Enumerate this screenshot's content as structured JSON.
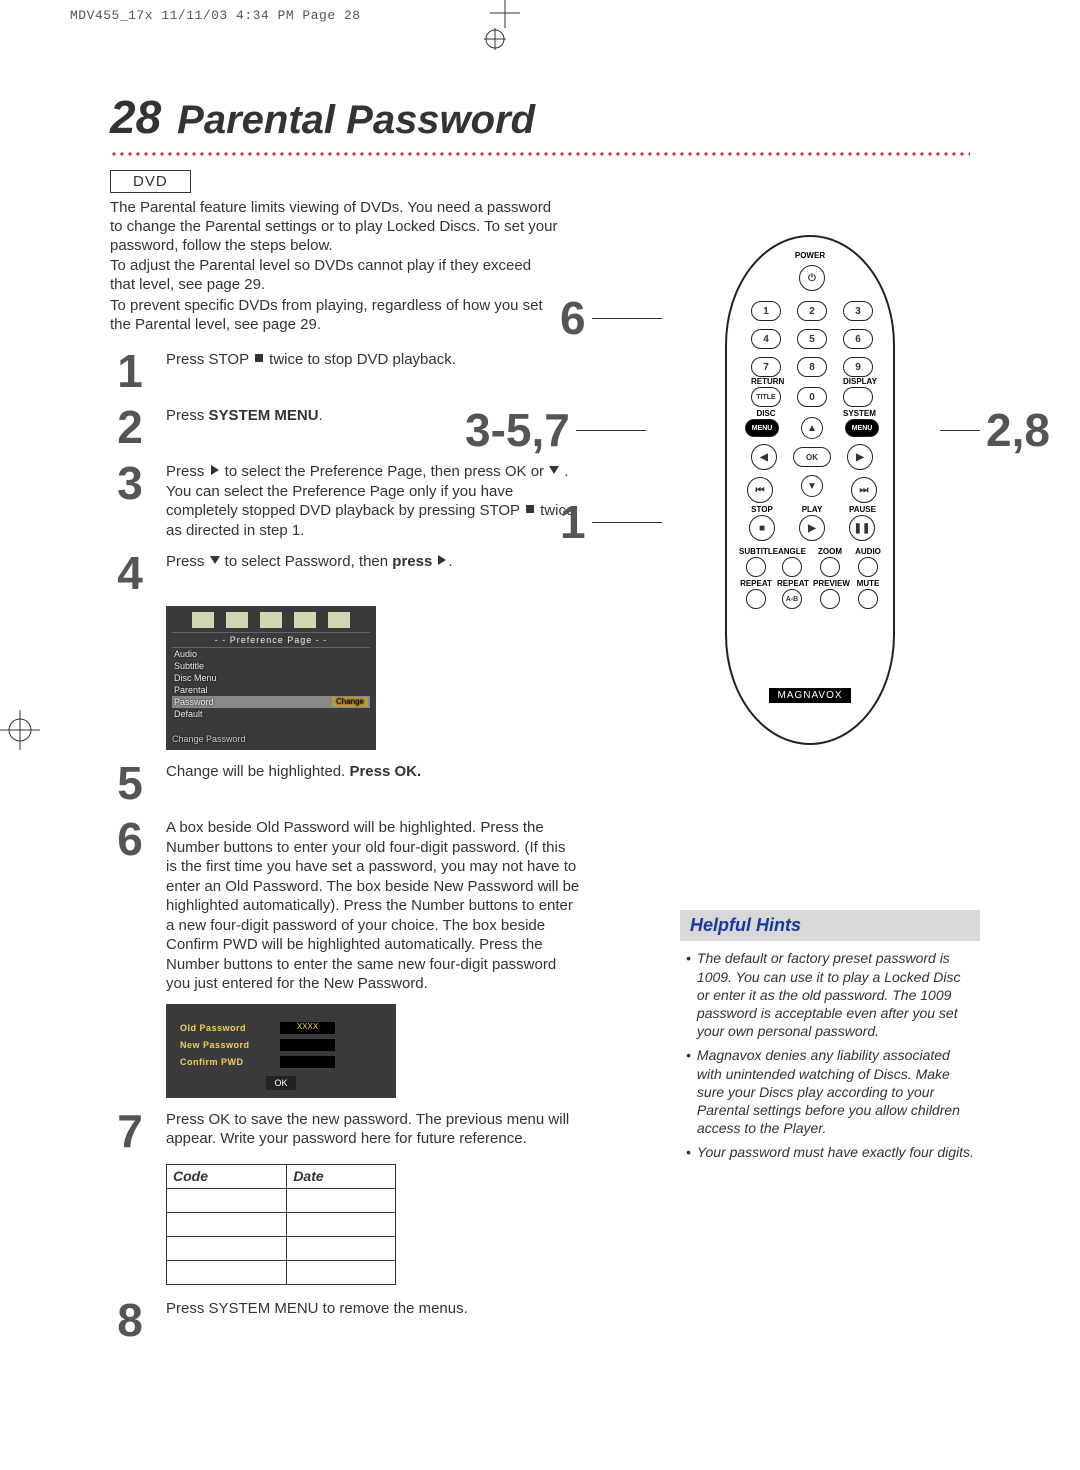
{
  "print_header": "MDV455_17x  11/11/03  4:34 PM  Page 28",
  "page_number": "28",
  "page_title": "Parental Password",
  "dvd_label": "DVD",
  "intro": {
    "p1": "The Parental feature limits viewing of DVDs. You need a password to change the Parental settings or to play Locked Discs. To set your password, follow the steps below.",
    "p2": "To adjust the Parental level so DVDs cannot play if they exceed that level, see page 29.",
    "p3": "To prevent specific DVDs from playing, regardless of how you set the Parental level, see page 29."
  },
  "steps": {
    "s1": {
      "n": "1",
      "a": "Press STOP ",
      "b": " twice to stop DVD playback."
    },
    "s2": {
      "n": "2",
      "a": "Press ",
      "bold": "SYSTEM MENU",
      "b": "."
    },
    "s3": {
      "n": "3",
      "a": "Press ",
      "b": " to select the Preference Page, then press OK or ",
      "c": " . You can select the Preference Page only if you have completely stopped DVD playback by pressing STOP ",
      "d": " twice as directed in step 1."
    },
    "s4": {
      "n": "4",
      "a": "Press ",
      "b": " to select Password, then ",
      "bold": "press ",
      "c": "."
    },
    "s5": {
      "n": "5",
      "a": "Change will be highlighted. ",
      "bold": "Press OK."
    },
    "s6": {
      "n": "6",
      "body": "A box beside Old Password will be highlighted. Press the Number buttons to enter your old four-digit password. (If this is the first time you have set a password, you may not have to enter an Old Password. The box beside New Password will be highlighted automatically). Press the Number buttons to enter a new four-digit password of your choice. The box beside Confirm PWD will be highlighted automatically. Press the Number buttons to enter the same new four-digit password you just entered for the New Password."
    },
    "s7": {
      "n": "7",
      "body": "Press OK to save the new password.  The previous menu will appear. Write your password here for future reference."
    },
    "s8": {
      "n": "8",
      "body": "Press SYSTEM MENU to remove the menus."
    }
  },
  "osd1": {
    "title": "- -   Preference Page   - -",
    "items": [
      "Audio",
      "Subtitle",
      "Disc Menu",
      "Parental",
      "Password",
      "Default"
    ],
    "change": "Change",
    "footer": "Change Password"
  },
  "osd2": {
    "old": "Old Password",
    "new": "New Password",
    "conf": "Confirm PWD",
    "ok": "OK"
  },
  "code_table": {
    "col1": "Code",
    "col2": "Date"
  },
  "remote": {
    "power": "POWER",
    "return": "RETURN",
    "display": "DISPLAY",
    "title": "TITLE",
    "disc": "DISC",
    "system": "SYSTEM",
    "menu": "MENU",
    "ok": "OK",
    "stop": "STOP",
    "play": "PLAY",
    "pause": "PAUSE",
    "subtitle": "SUBTITLE",
    "angle": "ANGLE",
    "zoom": "ZOOM",
    "audio": "AUDIO",
    "repeat": "REPEAT",
    "repeatab": "REPEAT",
    "ab": "A-B",
    "preview": "PREVIEW",
    "mute": "MUTE",
    "brand": "MAGNAVOX",
    "nums": {
      "1": "1",
      "2": "2",
      "3": "3",
      "4": "4",
      "5": "5",
      "6": "6",
      "7": "7",
      "8": "8",
      "9": "9",
      "0": "0"
    }
  },
  "callouts": {
    "c6": "6",
    "c357": "3-5,7",
    "c1": "1",
    "c28": "2,8"
  },
  "hints": {
    "title": "Helpful Hints",
    "h1": "The default or factory preset password is 1009. You can use it to play a Locked Disc or enter it as the old password. The 1009 password is acceptable even after you set your own personal password.",
    "h2": "Magnavox denies any liability associated with unintended watching of Discs. Make sure your Discs play according to your Parental settings before you allow children access to the Player.",
    "h3": "Your password must have exactly four digits."
  }
}
